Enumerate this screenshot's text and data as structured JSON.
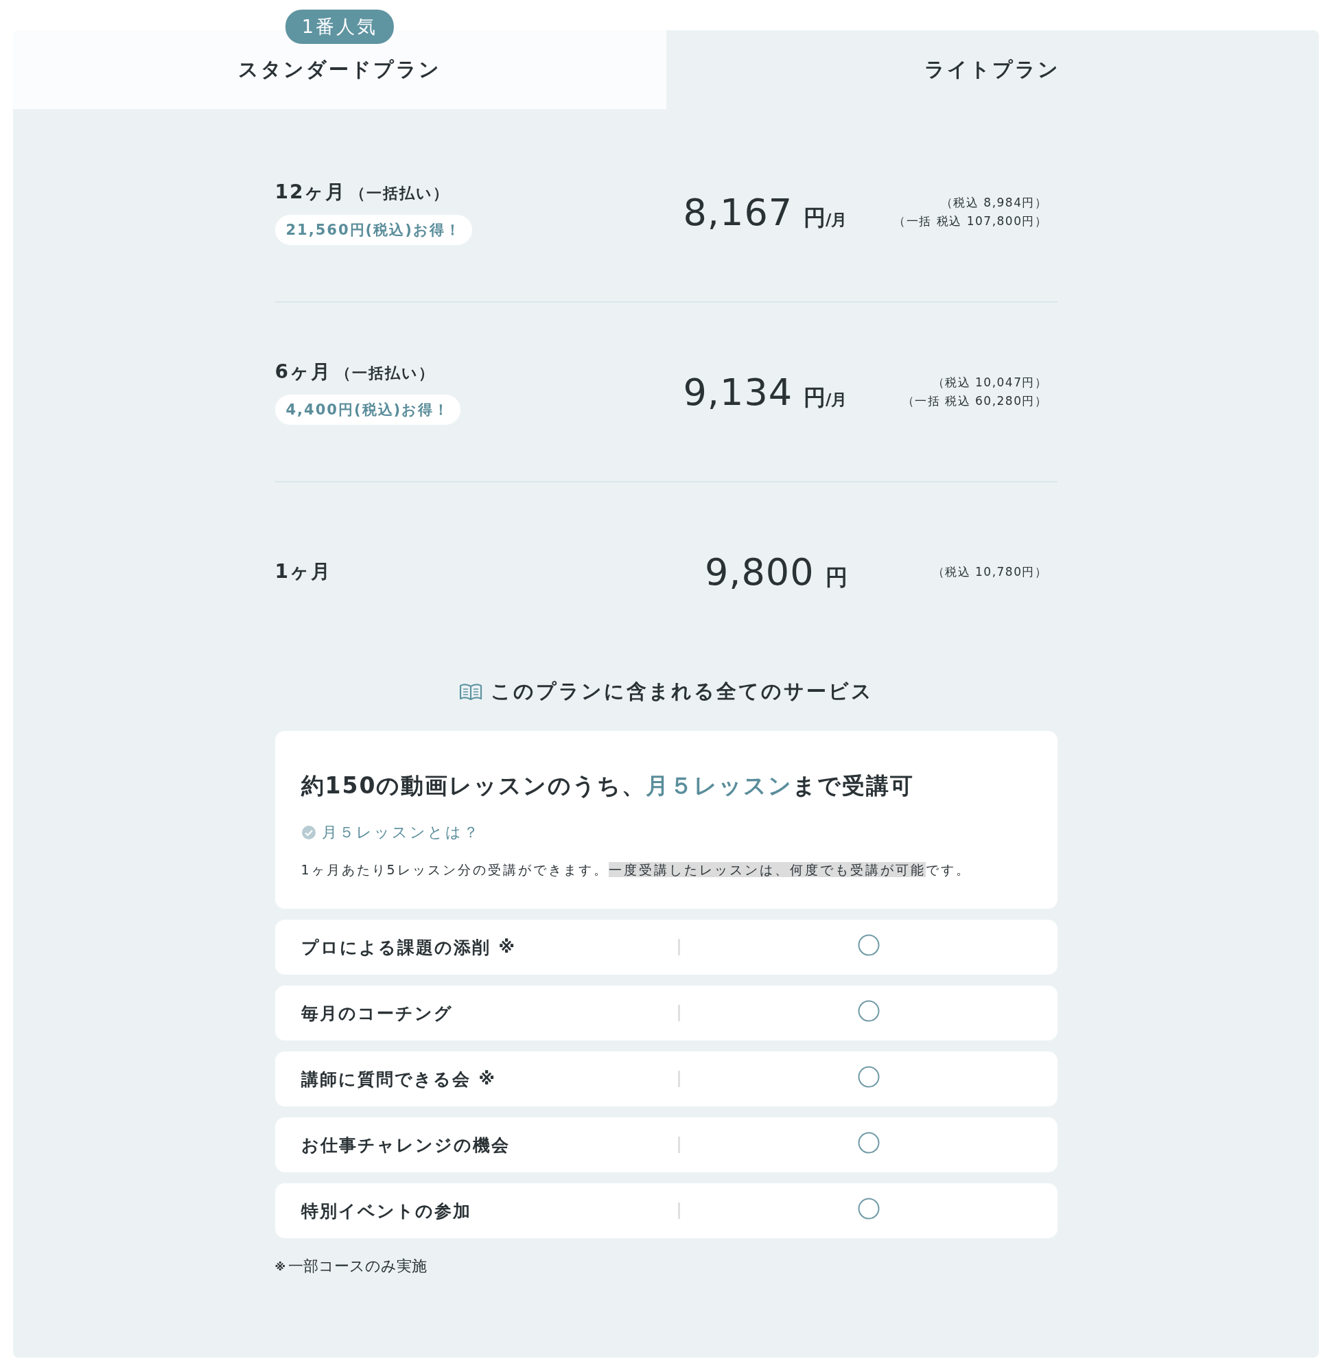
{
  "tabs": [
    {
      "label": "スタンダードプラン",
      "selected": true,
      "badge": "1番人気"
    },
    {
      "label": "ライトプラン",
      "selected": false
    }
  ],
  "plans": [
    {
      "term": "12ヶ月",
      "payment": "（一括払い）",
      "saving": "21,560円(税込)お得！",
      "price": "8,167",
      "unit": "円",
      "per": "/月",
      "tax_notes": [
        "（税込 8,984円）",
        "（一括 税込 107,800円）"
      ]
    },
    {
      "term": "6ヶ月",
      "payment": "（一括払い）",
      "saving": "4,400円(税込)お得！",
      "price": "9,134",
      "unit": "円",
      "per": "/月",
      "tax_notes": [
        "（税込 10,047円）",
        "（一括 税込 60,280円）"
      ]
    },
    {
      "term": "1ヶ月",
      "price": "9,800",
      "unit": "円",
      "tax_notes": [
        "（税込 10,780円）"
      ]
    }
  ],
  "services": {
    "heading": "このプランに含まれる全てのサービス",
    "lesson_card": {
      "title": [
        {
          "text": "約150の動画レッスンのうち、",
          "accent": false
        },
        {
          "text": "月５レッスン",
          "accent": true
        },
        {
          "text": "まで受講可",
          "accent": false
        }
      ],
      "question": "月５レッスンとは？",
      "description": [
        {
          "text": "1ヶ月あたり5レッスン分の受講ができます。",
          "highlighted": false
        },
        {
          "text": "一度受講したレッスンは、何度でも受講が可能",
          "highlighted": true
        },
        {
          "text": "です。",
          "highlighted": false
        }
      ]
    },
    "features": [
      {
        "label": "プロによる課題の添削",
        "mark": "※",
        "included": true
      },
      {
        "label": "毎月のコーチング",
        "included": true
      },
      {
        "label": "講師に質問できる会",
        "mark": "※",
        "included": true
      },
      {
        "label": "お仕事チャレンジの機会",
        "included": true
      },
      {
        "label": "特別イベントの参加",
        "included": true
      }
    ],
    "footnote_mark": "※",
    "footnote": "一部コースのみ実施"
  }
}
